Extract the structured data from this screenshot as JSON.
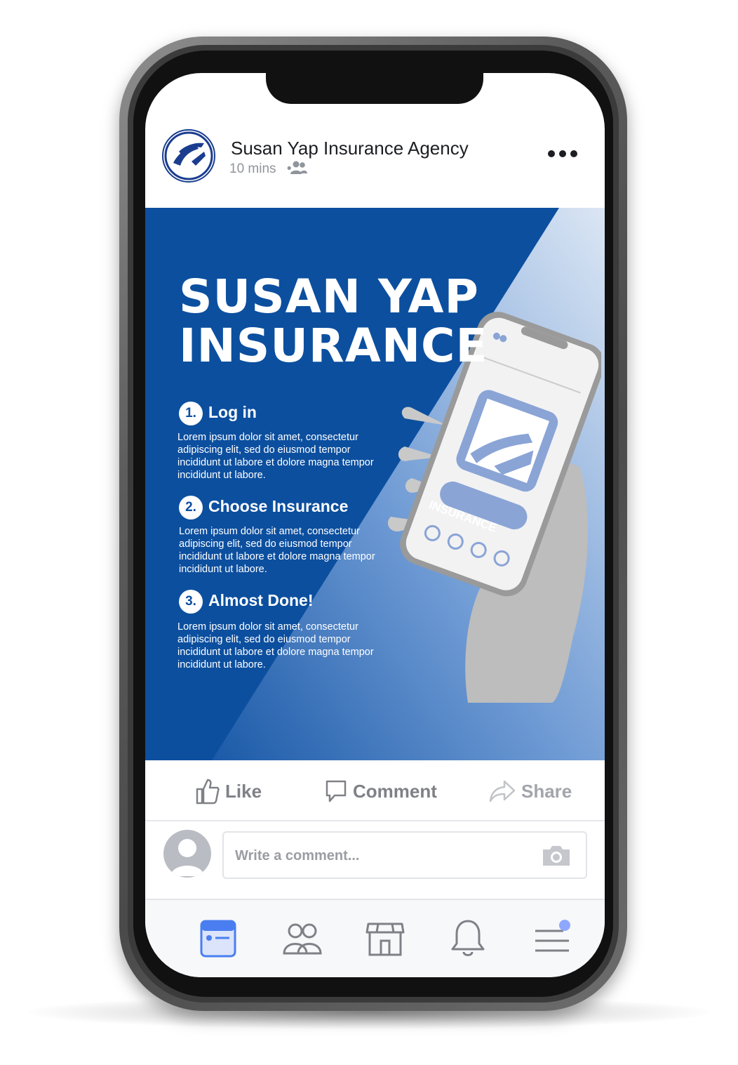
{
  "post": {
    "page_name": "Susan Yap Insurance Agency",
    "time": "10 mins",
    "separator": "•",
    "audience_icon": "friends-icon",
    "more_icon": "more-icon"
  },
  "creative": {
    "headline_line1": "SUSAN YAP",
    "headline_line2": "INSURANCE",
    "steps": [
      {
        "number": "1.",
        "title": "Log in",
        "body": "Lorem ipsum dolor sit amet, consectetur adipiscing elit, sed do eiusmod tempor incididunt ut labore et dolore magna tempor incididunt ut labore."
      },
      {
        "number": "2.",
        "title": "Choose Insurance",
        "body": "Lorem ipsum dolor sit amet, consectetur adipiscing elit, sed do eiusmod tempor incididunt ut labore et dolore magna tempor incididunt ut labore."
      },
      {
        "number": "3.",
        "title": "Almost Done!",
        "body": "Lorem ipsum dolor sit amet, consectetur adipiscing elit, sed do eiusmod tempor incididunt ut labore et dolore magna tempor incididunt ut labore."
      }
    ],
    "phone_button_label": "INSURANCE",
    "colors": {
      "brand_blue": "#0c4f9f",
      "light_blue": "#8fb0dc",
      "mock_blue": "#8aa4d6"
    }
  },
  "actions": {
    "like": "Like",
    "comment": "Comment",
    "share": "Share"
  },
  "comment_box": {
    "placeholder": "Write a comment..."
  },
  "nav": {
    "items": [
      "news-feed-icon",
      "friends-icon",
      "marketplace-icon",
      "notifications-icon",
      "menu-icon"
    ],
    "active_color": "#4a7ef0",
    "inactive_color": "#7f8187"
  }
}
